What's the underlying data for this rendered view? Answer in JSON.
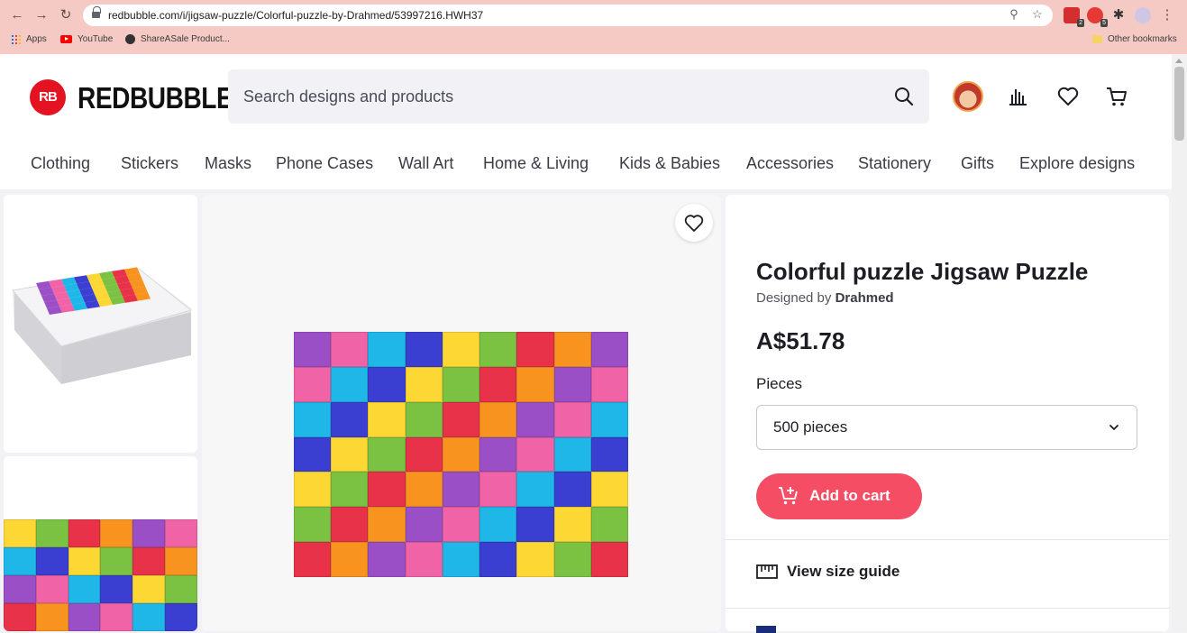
{
  "browser": {
    "url": "redbubble.com/i/jigsaw-puzzle/Colorful-puzzle-by-Drahmed/53997216.HWH37",
    "bookmarks": [
      {
        "label": "Apps",
        "icon": "apps-grid-icon"
      },
      {
        "label": "YouTube",
        "icon": "youtube-icon"
      },
      {
        "label": "ShareASale Product...",
        "icon": "globe-icon"
      }
    ],
    "other_bookmarks": "Other bookmarks",
    "extension_badges": [
      "2",
      "5"
    ]
  },
  "header": {
    "logo_text": "REDBUBBLE",
    "logo_mark": "RB",
    "search_placeholder": "Search designs and products"
  },
  "categories": [
    "Clothing",
    "Stickers",
    "Masks",
    "Phone Cases",
    "Wall Art",
    "Home & Living",
    "Kids & Babies",
    "Accessories",
    "Stationery",
    "Gifts",
    "Explore designs"
  ],
  "product": {
    "title": "Colorful puzzle Jigsaw Puzzle",
    "designed_prefix": "Designed by",
    "designer": "Drahmed",
    "price": "A$51.78",
    "pieces_label": "Pieces",
    "pieces_value": "500 pieces",
    "add_to_cart": "Add to cart",
    "size_guide": "View size guide"
  },
  "colors": {
    "brand": "#e41321",
    "cart_button": "#f54d64",
    "puzzle_palette": [
      "#e8324a",
      "#f7931e",
      "#fdd835",
      "#7cc242",
      "#1fb6e8",
      "#3b3fd1",
      "#9b4fc7",
      "#f063a6"
    ]
  }
}
